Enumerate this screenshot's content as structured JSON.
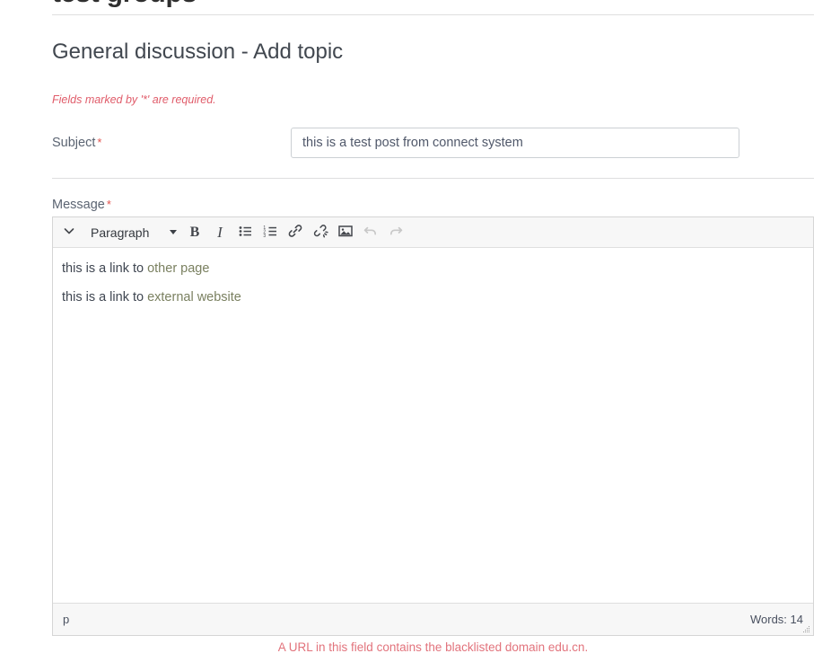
{
  "page": {
    "title": "test groups",
    "heading": "General discussion - Add topic",
    "required_note": "Fields marked by '*' are required.",
    "required_marker": "*"
  },
  "form": {
    "subject": {
      "label": "Subject",
      "value": "this is a test post from connect system",
      "placeholder": ""
    },
    "message": {
      "label": "Message"
    },
    "error": "A URL in this field contains the blacklisted domain edu.cn."
  },
  "editor": {
    "toolbar": {
      "toggle_icon": "chevron-down-icon",
      "format_label": "Paragraph",
      "bold_label": "B",
      "italic_label": "I",
      "buttons": [
        {
          "name": "bullist",
          "label": "Bullet list",
          "icon": "bullet-list-icon",
          "disabled": false
        },
        {
          "name": "numlist",
          "label": "Numbered list",
          "icon": "numbered-list-icon",
          "disabled": false
        },
        {
          "name": "link",
          "label": "Insert/edit link",
          "icon": "link-icon",
          "disabled": false
        },
        {
          "name": "unlink",
          "label": "Remove link",
          "icon": "unlink-icon",
          "disabled": false
        },
        {
          "name": "image",
          "label": "Insert/edit image",
          "icon": "image-icon",
          "disabled": false
        },
        {
          "name": "undo",
          "label": "Undo",
          "icon": "undo-icon",
          "disabled": true
        },
        {
          "name": "redo",
          "label": "Redo",
          "icon": "redo-icon",
          "disabled": true
        }
      ]
    },
    "body": {
      "paragraphs": [
        {
          "prefix": "this is a link to ",
          "link": "other page"
        },
        {
          "prefix": "this is a link to ",
          "link": "external website"
        }
      ]
    },
    "status": {
      "element_path": "p",
      "word_count": "Words: 14"
    }
  },
  "colors": {
    "error_text": "#e2737c",
    "required_text": "#e05c6a",
    "link_text": "#7a8060",
    "toolbar_bg": "#f7f7f7",
    "border": "#d5d5d5"
  }
}
